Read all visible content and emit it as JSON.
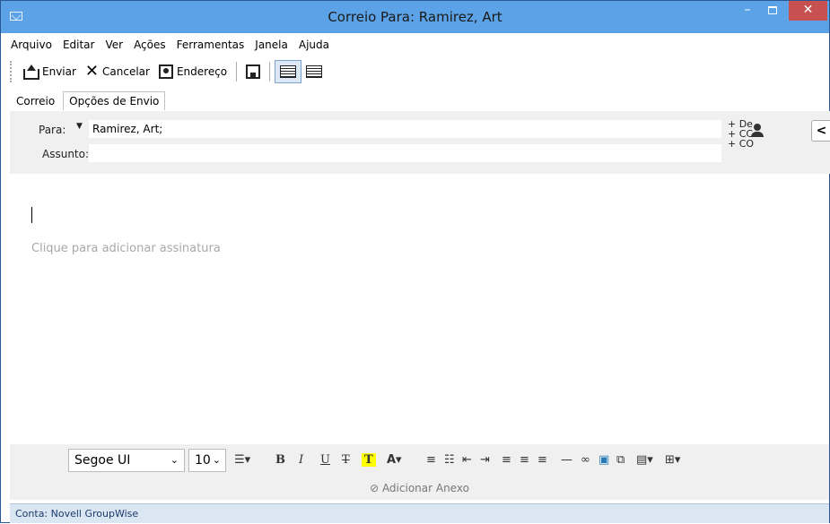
{
  "window": {
    "title": "Correio Para: Ramirez, Art"
  },
  "menu": [
    "Arquivo",
    "Editar",
    "Ver",
    "Ações",
    "Ferramentas",
    "Janela",
    "Ajuda"
  ],
  "toolbar": {
    "send": "Enviar",
    "cancel": "Cancelar",
    "address": "Endereço"
  },
  "tabs": [
    "Correio",
    "Opções de Envio"
  ],
  "header": {
    "to_label": "Para:",
    "to_value": "Ramirez, Art;",
    "subject_label": "Assunto:",
    "subject_value": "",
    "add_from": "+ De",
    "add_cc": "+ CC",
    "add_bcc": "+ CO"
  },
  "body": {
    "signature_placeholder": "Clique para adicionar assinatura"
  },
  "format": {
    "font": "Segoe UI",
    "size": "10"
  },
  "attach_label": "Adicionar Anexo",
  "status": "Conta: Novell GroupWise"
}
